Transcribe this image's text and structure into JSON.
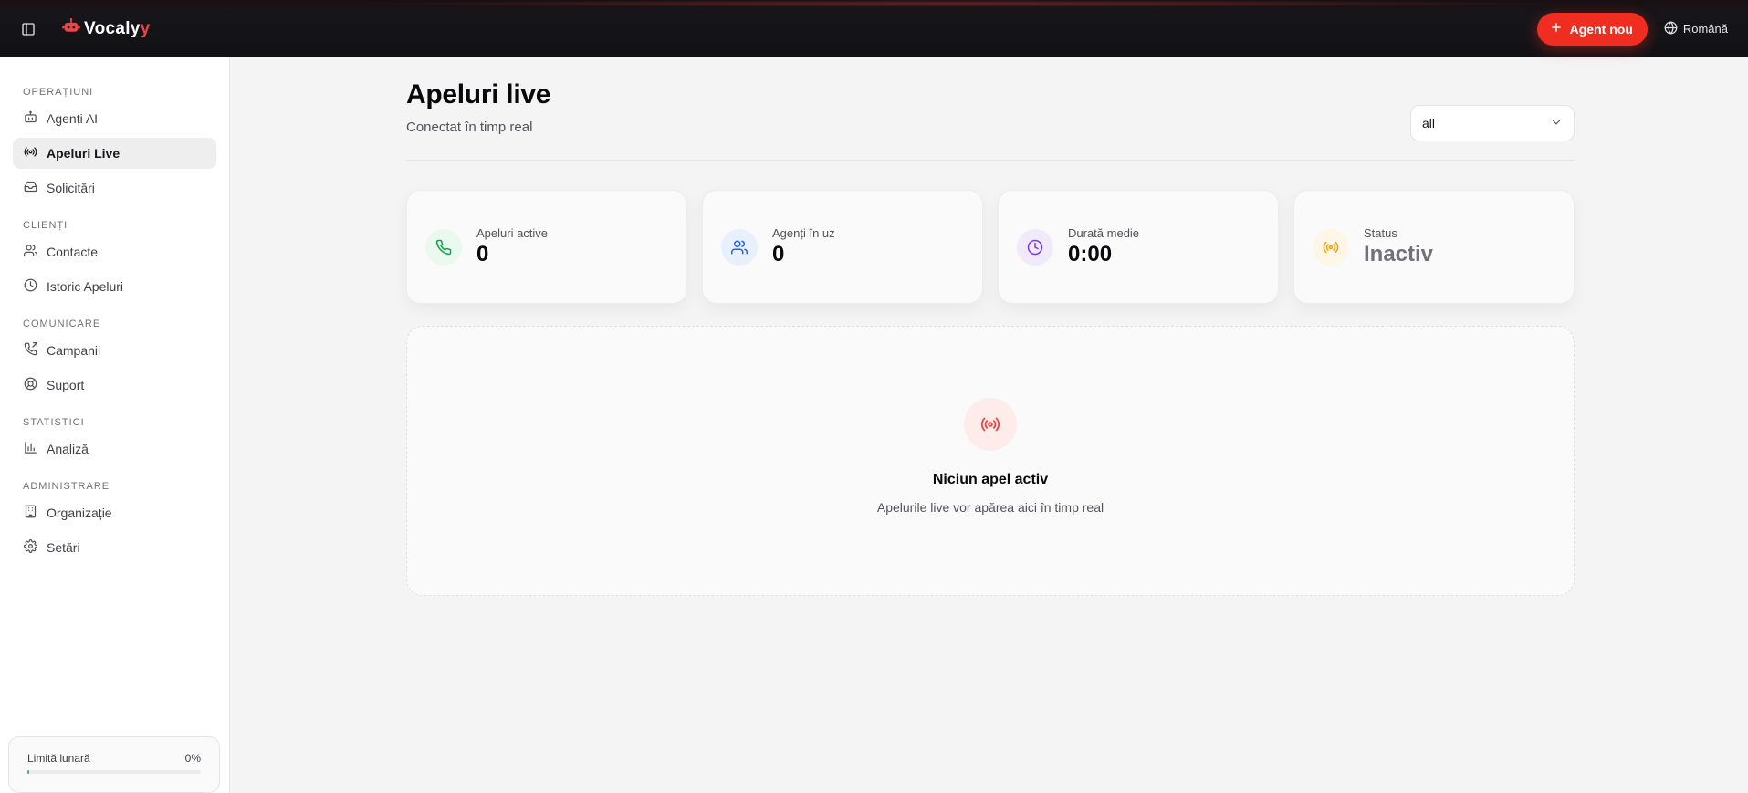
{
  "app": {
    "name_main": "Vocaly",
    "name_accent": "y"
  },
  "header": {
    "new_agent_label": "Agent nou",
    "language": "Română"
  },
  "sidebar": {
    "sections": [
      {
        "title": "OPERAȚIUNI",
        "items": [
          {
            "label": "Agenți AI",
            "icon": "bot-icon"
          },
          {
            "label": "Apeluri Live",
            "icon": "radio-icon",
            "active": true
          },
          {
            "label": "Solicitări",
            "icon": "inbox-icon"
          }
        ]
      },
      {
        "title": "CLIENȚI",
        "items": [
          {
            "label": "Contacte",
            "icon": "users-icon"
          },
          {
            "label": "Istoric Apeluri",
            "icon": "clock-icon"
          }
        ]
      },
      {
        "title": "COMUNICARE",
        "items": [
          {
            "label": "Campanii",
            "icon": "phone-outgoing-icon"
          },
          {
            "label": "Suport",
            "icon": "lifebuoy-icon"
          }
        ]
      },
      {
        "title": "STATISTICI",
        "items": [
          {
            "label": "Analiză",
            "icon": "bar-chart-icon"
          }
        ]
      },
      {
        "title": "ADMINISTRARE",
        "items": [
          {
            "label": "Organizație",
            "icon": "building-icon"
          },
          {
            "label": "Setări",
            "icon": "gear-icon"
          }
        ]
      }
    ],
    "limit": {
      "label": "Limită lunară",
      "value": "0%",
      "fraction": 0.0
    }
  },
  "main": {
    "title": "Apeluri live",
    "subtitle": "Conectat în timp real",
    "filter": {
      "selected": "all"
    },
    "stats": [
      {
        "label": "Apeluri active",
        "value": "0",
        "icon": "phone-icon",
        "color": "#16a34a",
        "bg": "#e9f9ef"
      },
      {
        "label": "Agenți în uz",
        "value": "0",
        "icon": "users-icon",
        "color": "#2563eb",
        "bg": "#e8effd"
      },
      {
        "label": "Durată medie",
        "value": "0:00",
        "icon": "clock-icon",
        "color": "#7c3aed",
        "bg": "#f1eafd"
      },
      {
        "label": "Status",
        "value": "Inactiv",
        "icon": "radio-icon",
        "color": "#f59e0b",
        "bg": "#fef6e6"
      }
    ],
    "empty": {
      "title": "Niciun apel activ",
      "text": "Apelurile live vor apărea aici în timp real"
    }
  },
  "colors": {
    "accent": "#ef2d21",
    "sidebar_bg": "#ffffff",
    "page_bg": "#f4f4f5"
  }
}
